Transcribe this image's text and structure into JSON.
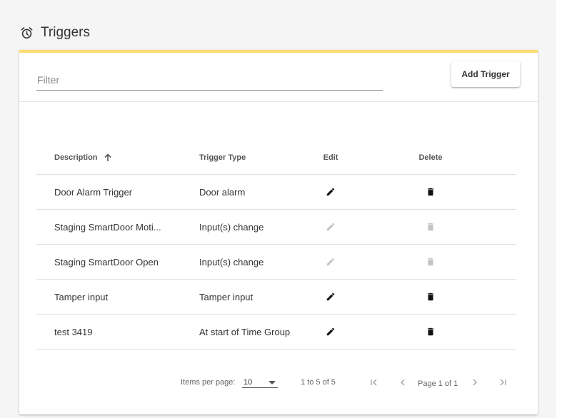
{
  "header": {
    "icon": "alarm-clock-icon",
    "title": "Triggers"
  },
  "colors": {
    "accent": "#fddc73",
    "enabled_icon": "#111111",
    "disabled_icon": "#c4c4c4"
  },
  "toolbar": {
    "filter_placeholder": "Filter",
    "filter_value": "",
    "add_button_label": "Add Trigger"
  },
  "table": {
    "columns": {
      "description": "Description",
      "trigger_type": "Trigger Type",
      "edit": "Edit",
      "delete": "Delete"
    },
    "sort": {
      "column": "description",
      "direction": "ascending",
      "icon": "arrow-up-icon"
    },
    "rows": [
      {
        "description": "Door Alarm Trigger",
        "trigger_type": "Door alarm",
        "edit_enabled": true,
        "delete_enabled": true
      },
      {
        "description": "Staging SmartDoor Moti...",
        "trigger_type": "Input(s) change",
        "edit_enabled": false,
        "delete_enabled": false
      },
      {
        "description": "Staging SmartDoor Open",
        "trigger_type": "Input(s) change",
        "edit_enabled": false,
        "delete_enabled": false
      },
      {
        "description": "Tamper input",
        "trigger_type": "Tamper input",
        "edit_enabled": true,
        "delete_enabled": true
      },
      {
        "description": "test 3419",
        "trigger_type": "At start of Time Group",
        "edit_enabled": true,
        "delete_enabled": true
      }
    ]
  },
  "paginator": {
    "items_per_page_label": "Items per page:",
    "items_per_page_value": "10",
    "range_label": "1 to 5 of 5",
    "page_label": "Page 1 of 1",
    "buttons": [
      "first-page-icon",
      "previous-page-icon",
      "next-page-icon",
      "last-page-icon"
    ]
  }
}
